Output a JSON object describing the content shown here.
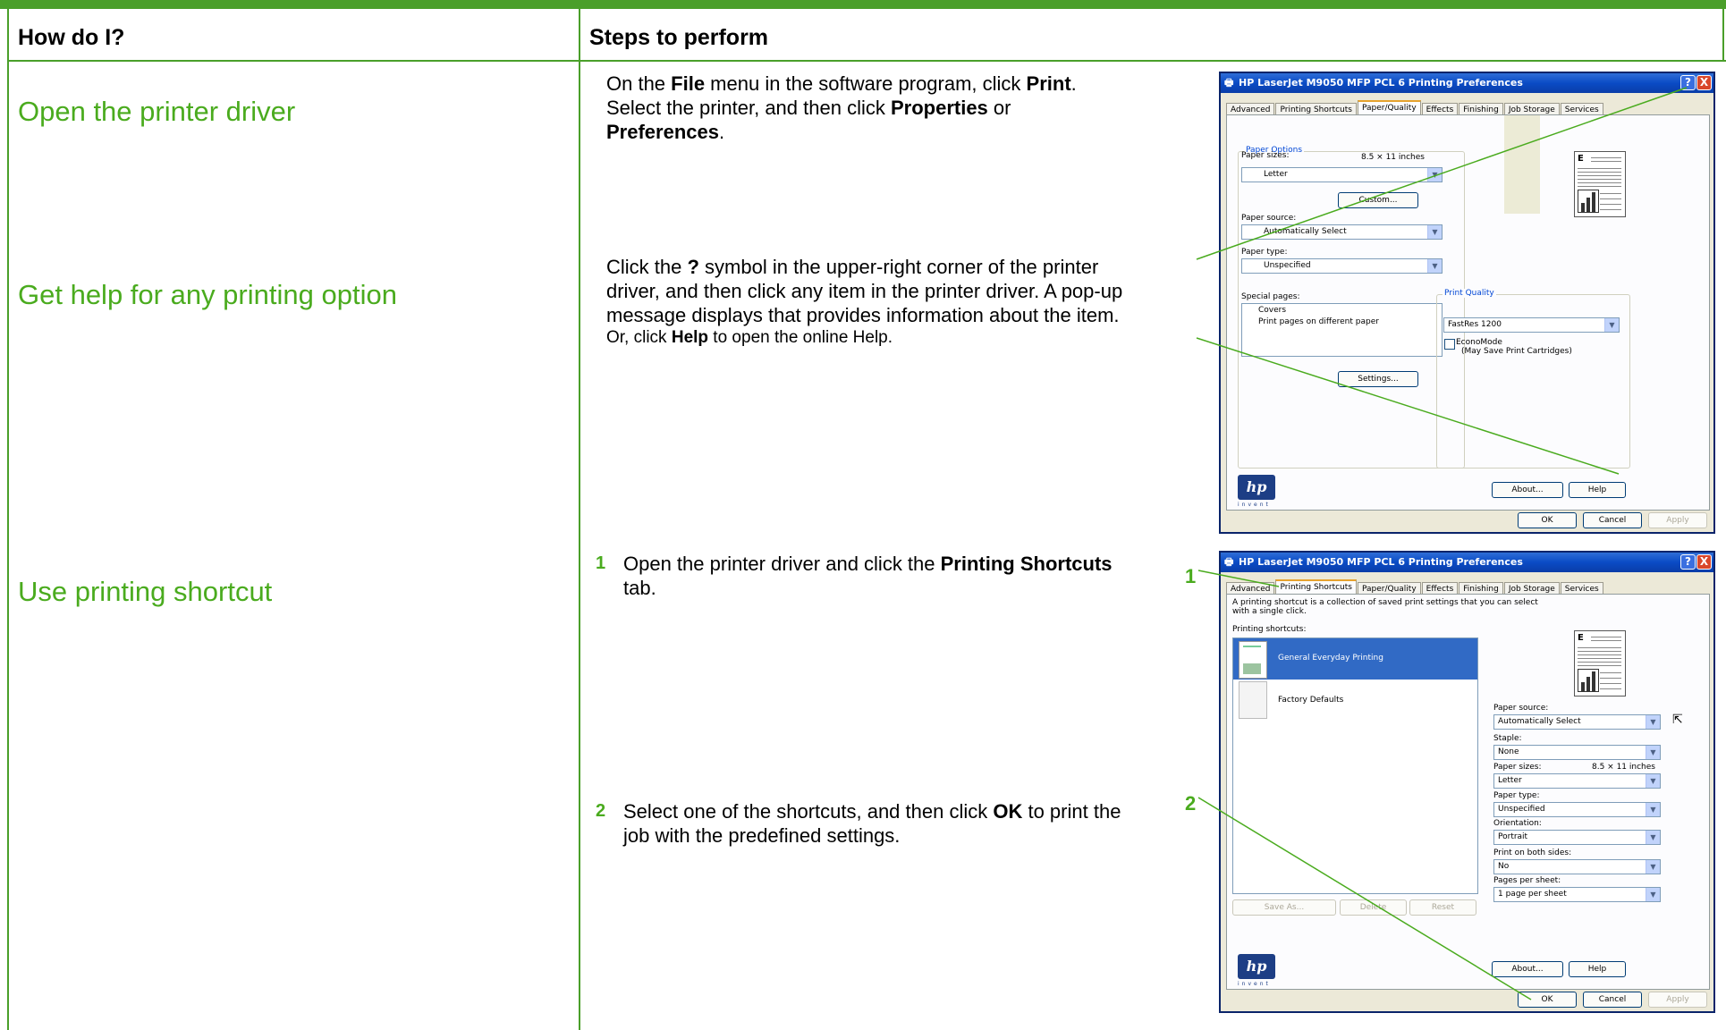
{
  "table": {
    "col1_header": "How do I?",
    "col2_header": "Steps to perform"
  },
  "rows": {
    "open_driver": {
      "task": "Open the printer driver",
      "line1_pre": "On the ",
      "line1_b1": "File",
      "line1_mid": " menu in the software program, click ",
      "line1_b2": "Print",
      "line1_end": ".",
      "line2_pre": "Select the printer, and then click ",
      "line2_b1": "Properties",
      "line2_end": " or",
      "line3_b": "Preferences",
      "line3_end": "."
    },
    "get_help": {
      "task": "Get help for any printing option",
      "l1_pre": "Click the ",
      "l1_b": "?",
      "l1_end": " symbol in the upper-right corner of the printer",
      "l2": "driver, and then click any item in the printer driver. A pop-up",
      "l3": "message displays that provides information about the item.",
      "l4_pre": "Or, click ",
      "l4_b": "Help",
      "l4_end": " to open the online Help."
    },
    "shortcut": {
      "task": "Use printing shortcut",
      "step1_num": "1",
      "step1_pre": "Open the printer driver and click the ",
      "step1_b": "Printing Shortcuts",
      "step1_end": "tab.",
      "step2_num": "2",
      "step2_pre": "Select one of the shortcuts, and then click ",
      "step2_b": "OK",
      "step2_mid": " to print the",
      "step2_end": "job with the predefined settings.",
      "callout1": "1",
      "callout2": "2"
    }
  },
  "dialog": {
    "title": "HP LaserJet M9050 MFP PCL 6 Printing Preferences",
    "help_btn": "?",
    "close_btn": "X",
    "tabs": [
      "Advanced",
      "Printing Shortcuts",
      "Paper/Quality",
      "Effects",
      "Finishing",
      "Job Storage",
      "Services"
    ],
    "ok": "OK",
    "cancel": "Cancel",
    "apply": "Apply",
    "about": "About...",
    "help": "Help",
    "hp_logo": "hp",
    "hp_invent": "invent",
    "preview_letter": "E"
  },
  "paper_quality": {
    "paper_options": "Paper Options",
    "paper_sizes": "Paper sizes:",
    "size_value": "8.5 × 11 inches",
    "size_select": "Letter",
    "custom": "Custom...",
    "paper_source": "Paper source:",
    "source_select": "Automatically Select",
    "paper_type": "Paper type:",
    "type_select": "Unspecified",
    "special_pages": "Special pages:",
    "special_items": [
      "Covers",
      "Print pages on different paper"
    ],
    "settings": "Settings...",
    "print_quality": "Print Quality",
    "quality_select": "FastRes 1200",
    "economode": "EconoMode",
    "economode_sub": "(May Save Print Cartridges)"
  },
  "shortcuts": {
    "desc1": "A printing shortcut is a collection of saved print settings that you can select",
    "desc2": "with a single click.",
    "label": "Printing shortcuts:",
    "items": [
      "General Everyday Printing",
      "Factory Defaults"
    ],
    "save_as": "Save As...",
    "delete": "Delete",
    "reset": "Reset",
    "fields": [
      {
        "label": "Paper source:",
        "value": "Automatically Select"
      },
      {
        "label": "Staple:",
        "value": "None"
      },
      {
        "label": "Paper sizes:",
        "value": "Letter",
        "extra": "8.5 × 11 inches"
      },
      {
        "label": "Paper type:",
        "value": "Unspecified"
      },
      {
        "label": "Orientation:",
        "value": "Portrait"
      },
      {
        "label": "Print on both sides:",
        "value": "No"
      },
      {
        "label": "Pages per sheet:",
        "value": "1 page per sheet"
      }
    ]
  },
  "colors": {
    "accent_green": "#4aab1e",
    "grid_line": "#4a9f2a",
    "xp_title": "#0a4bc5",
    "selection": "#316ac5"
  }
}
